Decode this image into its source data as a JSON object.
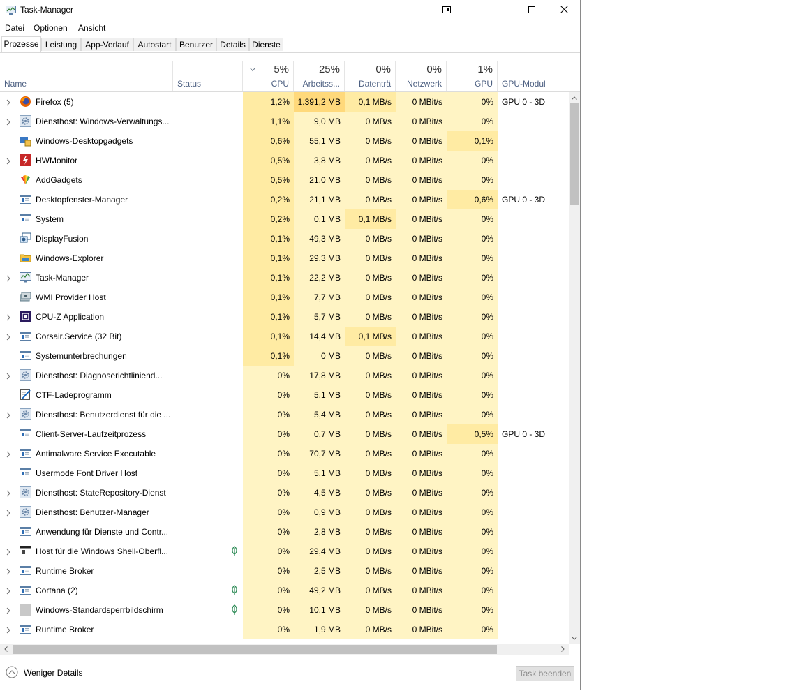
{
  "window": {
    "title": "Task-Manager"
  },
  "menu": [
    "Datei",
    "Optionen",
    "Ansicht"
  ],
  "tabs": [
    "Prozesse",
    "Leistung",
    "App-Verlauf",
    "Autostart",
    "Benutzer",
    "Details",
    "Dienste"
  ],
  "active_tab": "Prozesse",
  "columns": {
    "name": "Name",
    "status": "Status",
    "cpu": {
      "percent": "5%",
      "label": "CPU"
    },
    "mem": {
      "percent": "25%",
      "label": "Arbeitss..."
    },
    "disk": {
      "percent": "0%",
      "label": "Datenträ"
    },
    "net": {
      "percent": "0%",
      "label": "Netzwerk"
    },
    "gpu": {
      "percent": "1%",
      "label": "GPU"
    },
    "gpu_engine": "GPU-Modul"
  },
  "processes": [
    {
      "name": "Firefox (5)",
      "icon": "firefox-icon",
      "expandable": true,
      "cpu": "1,2%",
      "mem": "1.391,2 MB",
      "disk": "0,1 MB/s",
      "net": "0 MBit/s",
      "gpu": "0%",
      "gpu_engine": "GPU 0 - 3D"
    },
    {
      "name": "Diensthost: Windows-Verwaltungs...",
      "icon": "gear-icon",
      "expandable": true,
      "cpu": "1,1%",
      "mem": "9,0 MB",
      "disk": "0 MB/s",
      "net": "0 MBit/s",
      "gpu": "0%"
    },
    {
      "name": "Windows-Desktopgadgets",
      "icon": "gadgets-icon",
      "expandable": false,
      "cpu": "0,6%",
      "mem": "55,1 MB",
      "disk": "0 MB/s",
      "net": "0 MBit/s",
      "gpu": "0,1%"
    },
    {
      "name": "HWMonitor",
      "icon": "hwmonitor-icon",
      "expandable": true,
      "cpu": "0,5%",
      "mem": "3,8 MB",
      "disk": "0 MB/s",
      "net": "0 MBit/s",
      "gpu": "0%"
    },
    {
      "name": "AddGadgets",
      "icon": "addgadgets-icon",
      "expandable": false,
      "cpu": "0,5%",
      "mem": "21,0 MB",
      "disk": "0 MB/s",
      "net": "0 MBit/s",
      "gpu": "0%"
    },
    {
      "name": "Desktopfenster-Manager",
      "icon": "window-icon",
      "expandable": false,
      "cpu": "0,2%",
      "mem": "21,1 MB",
      "disk": "0 MB/s",
      "net": "0 MBit/s",
      "gpu": "0,6%",
      "gpu_engine": "GPU 0 - 3D"
    },
    {
      "name": "System",
      "icon": "window-icon",
      "expandable": false,
      "cpu": "0,2%",
      "mem": "0,1 MB",
      "disk": "0,1 MB/s",
      "net": "0 MBit/s",
      "gpu": "0%"
    },
    {
      "name": "DisplayFusion",
      "icon": "displayfusion-icon",
      "expandable": false,
      "cpu": "0,1%",
      "mem": "49,3 MB",
      "disk": "0 MB/s",
      "net": "0 MBit/s",
      "gpu": "0%"
    },
    {
      "name": "Windows-Explorer",
      "icon": "folder-icon",
      "expandable": false,
      "cpu": "0,1%",
      "mem": "29,3 MB",
      "disk": "0 MB/s",
      "net": "0 MBit/s",
      "gpu": "0%"
    },
    {
      "name": "Task-Manager",
      "icon": "taskmanager-icon",
      "expandable": true,
      "cpu": "0,1%",
      "mem": "22,2 MB",
      "disk": "0 MB/s",
      "net": "0 MBit/s",
      "gpu": "0%"
    },
    {
      "name": "WMI Provider Host",
      "icon": "wmi-icon",
      "expandable": false,
      "cpu": "0,1%",
      "mem": "7,7 MB",
      "disk": "0 MB/s",
      "net": "0 MBit/s",
      "gpu": "0%"
    },
    {
      "name": "CPU-Z Application",
      "icon": "cpuz-icon",
      "expandable": true,
      "cpu": "0,1%",
      "mem": "5,7 MB",
      "disk": "0 MB/s",
      "net": "0 MBit/s",
      "gpu": "0%"
    },
    {
      "name": "Corsair.Service (32 Bit)",
      "icon": "window-icon",
      "expandable": true,
      "cpu": "0,1%",
      "mem": "14,4 MB",
      "disk": "0,1 MB/s",
      "net": "0 MBit/s",
      "gpu": "0%"
    },
    {
      "name": "Systemunterbrechungen",
      "icon": "window-icon",
      "expandable": false,
      "cpu": "0,1%",
      "mem": "0 MB",
      "disk": "0 MB/s",
      "net": "0 MBit/s",
      "gpu": "0%"
    },
    {
      "name": "Diensthost: Diagnoserichtliniend...",
      "icon": "gear-icon",
      "expandable": true,
      "cpu": "0%",
      "mem": "17,8 MB",
      "disk": "0 MB/s",
      "net": "0 MBit/s",
      "gpu": "0%"
    },
    {
      "name": "CTF-Ladeprogramm",
      "icon": "ctf-icon",
      "expandable": false,
      "cpu": "0%",
      "mem": "5,1 MB",
      "disk": "0 MB/s",
      "net": "0 MBit/s",
      "gpu": "0%"
    },
    {
      "name": "Diensthost: Benutzerdienst für die ...",
      "icon": "gear-icon",
      "expandable": true,
      "cpu": "0%",
      "mem": "5,4 MB",
      "disk": "0 MB/s",
      "net": "0 MBit/s",
      "gpu": "0%"
    },
    {
      "name": "Client-Server-Laufzeitprozess",
      "icon": "window-icon",
      "expandable": false,
      "cpu": "0%",
      "mem": "0,7 MB",
      "disk": "0 MB/s",
      "net": "0 MBit/s",
      "gpu": "0,5%",
      "gpu_engine": "GPU 0 - 3D"
    },
    {
      "name": "Antimalware Service Executable",
      "icon": "window-icon",
      "expandable": true,
      "cpu": "0%",
      "mem": "70,7 MB",
      "disk": "0 MB/s",
      "net": "0 MBit/s",
      "gpu": "0%"
    },
    {
      "name": "Usermode Font Driver Host",
      "icon": "window-icon",
      "expandable": false,
      "cpu": "0%",
      "mem": "5,1 MB",
      "disk": "0 MB/s",
      "net": "0 MBit/s",
      "gpu": "0%"
    },
    {
      "name": "Diensthost: StateRepository-Dienst",
      "icon": "gear-icon",
      "expandable": true,
      "cpu": "0%",
      "mem": "4,5 MB",
      "disk": "0 MB/s",
      "net": "0 MBit/s",
      "gpu": "0%"
    },
    {
      "name": "Diensthost: Benutzer-Manager",
      "icon": "gear-icon",
      "expandable": true,
      "cpu": "0%",
      "mem": "0,9 MB",
      "disk": "0 MB/s",
      "net": "0 MBit/s",
      "gpu": "0%"
    },
    {
      "name": "Anwendung für Dienste und Contr...",
      "icon": "window-icon",
      "expandable": false,
      "cpu": "0%",
      "mem": "2,8 MB",
      "disk": "0 MB/s",
      "net": "0 MBit/s",
      "gpu": "0%"
    },
    {
      "name": "Host für die Windows Shell-Oberfl...",
      "icon": "shell-icon",
      "expandable": true,
      "suspended": true,
      "cpu": "0%",
      "mem": "29,4 MB",
      "disk": "0 MB/s",
      "net": "0 MBit/s",
      "gpu": "0%"
    },
    {
      "name": "Runtime Broker",
      "icon": "window-icon",
      "expandable": true,
      "cpu": "0%",
      "mem": "2,5 MB",
      "disk": "0 MB/s",
      "net": "0 MBit/s",
      "gpu": "0%"
    },
    {
      "name": "Cortana (2)",
      "icon": "window-icon",
      "expandable": true,
      "suspended": true,
      "cpu": "0%",
      "mem": "49,2 MB",
      "disk": "0 MB/s",
      "net": "0 MBit/s",
      "gpu": "0%"
    },
    {
      "name": "Windows-Standardsperrbildschirm",
      "icon": "blank-icon",
      "expandable": true,
      "suspended": true,
      "cpu": "0%",
      "mem": "10,1 MB",
      "disk": "0 MB/s",
      "net": "0 MBit/s",
      "gpu": "0%"
    },
    {
      "name": "Runtime Broker",
      "icon": "window-icon",
      "expandable": true,
      "cpu": "0%",
      "mem": "1,9 MB",
      "disk": "0 MB/s",
      "net": "0 MBit/s",
      "gpu": "0%"
    }
  ],
  "footer": {
    "fewer_details": "Weniger Details",
    "end_task": "Task beenden"
  },
  "colors": {
    "heat_light": "#fff4c4",
    "heat_mid": "#ffeba3",
    "heat_high": "#ffd97b",
    "header_text": "#4d6082"
  }
}
